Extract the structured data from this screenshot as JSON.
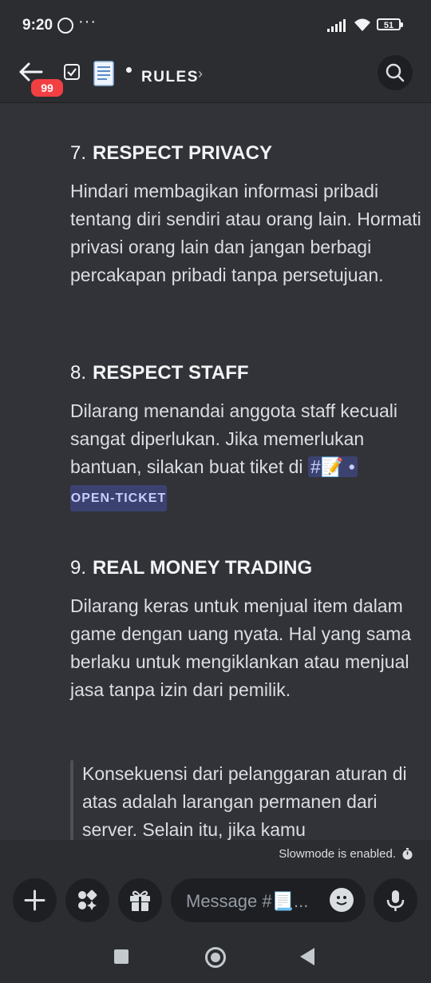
{
  "status_bar": {
    "time": "9:20",
    "battery": "51",
    "icons": [
      "whatsapp-icon",
      "more-dots-icon",
      "signal-icon",
      "wifi-icon",
      "battery-icon"
    ]
  },
  "header": {
    "unread_badge": "99",
    "channel_name": "RULES",
    "icons": [
      "back-arrow-icon",
      "checklist-icon",
      "page-emoji-icon",
      "chevron-right-icon",
      "search-icon"
    ]
  },
  "rules": [
    {
      "number": "7.",
      "title": "RESPECT PRIVACY",
      "body": "Hindari membagikan informasi pribadi tentang diri sendiri atau orang lain. Hormati privasi orang lain dan jangan berbagi percakapan pribadi tanpa persetujuan."
    },
    {
      "number": "8.",
      "title": "RESPECT STAFF",
      "body": "Dilarang menandai anggota staff kecuali sangat diperlukan. Jika memerlukan bantuan, silakan buat tiket di",
      "mention_prefix": "#📝 •",
      "mention_channel": "OPEN-TICKET"
    },
    {
      "number": "9.",
      "title": "REAL MONEY TRADING",
      "body": "Dilarang keras untuk menjual item dalam game dengan uang nyata. Hal yang sama berlaku untuk mengiklankan atau menjual jasa tanpa izin dari pemilik."
    }
  ],
  "quote": "Konsekuensi dari pelanggaran aturan di atas adalah larangan permanen dari server. Selain itu, jika kamu",
  "slowmode": {
    "text": "Slowmode is enabled."
  },
  "composer": {
    "placeholder": "Message #📃...",
    "buttons": [
      "plus-icon",
      "apps-icon",
      "gift-icon",
      "emoji-icon",
      "microphone-icon"
    ]
  },
  "colors": {
    "background": "#313338",
    "bar": "#2b2d31",
    "mention_bg": "#3c4270",
    "badge": "#f23f43"
  }
}
